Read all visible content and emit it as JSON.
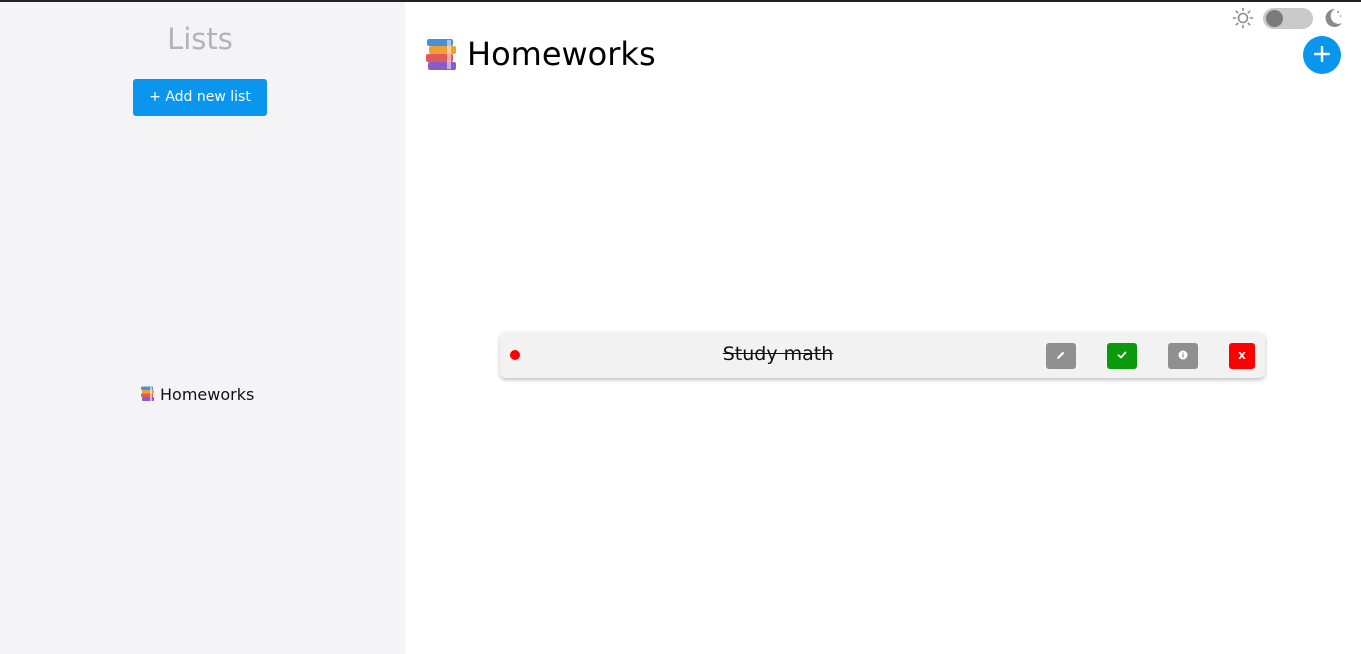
{
  "sidebar": {
    "title": "Lists",
    "add_list_label": "+ Add new list",
    "items": [
      {
        "label": "Homeworks",
        "icon": "books-icon"
      }
    ]
  },
  "theme_toggle": {
    "light_icon": "sun-icon",
    "dark_icon": "moon-icon",
    "state": "light"
  },
  "main": {
    "title": "Homeworks",
    "icon": "books-icon",
    "add_task_icon": "plus-icon",
    "tasks": [
      {
        "text": "Study math",
        "completed": true,
        "priority_color": "#ff0000",
        "delete_label": "X",
        "actions": [
          "edit",
          "complete",
          "info",
          "delete"
        ]
      }
    ]
  },
  "colors": {
    "accent": "#0a96ee",
    "done": "#0b9a0b",
    "delete": "#ff0000",
    "neutral_button": "#8f8f8f"
  }
}
